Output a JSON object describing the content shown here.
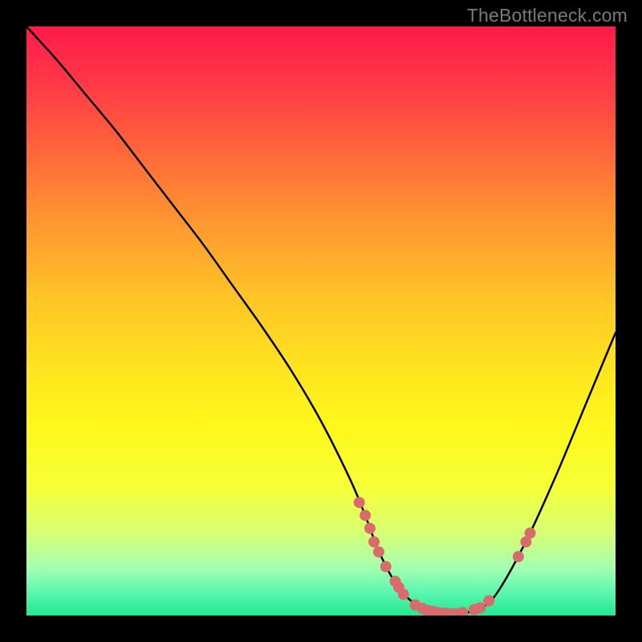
{
  "watermark": "TheBottleneck.com",
  "chart_data": {
    "type": "line",
    "title": "",
    "xlabel": "",
    "ylabel": "",
    "xlim": [
      0,
      100
    ],
    "ylim": [
      0,
      100
    ],
    "grid": false,
    "legend": false,
    "curve": {
      "x": [
        0,
        5,
        10,
        15,
        20,
        25,
        30,
        35,
        40,
        45,
        50,
        55,
        57.5,
        60,
        63,
        66,
        70,
        73,
        77,
        80,
        85,
        90,
        95,
        100
      ],
      "y": [
        100,
        94.5,
        88.5,
        82.5,
        76,
        69.5,
        63,
        56,
        49,
        41.5,
        33,
        23,
        17,
        10.5,
        5,
        2,
        0.5,
        0.3,
        1.2,
        4,
        13,
        24,
        36,
        48
      ]
    },
    "points": [
      {
        "x": 56.5,
        "y": 19.2
      },
      {
        "x": 57.5,
        "y": 17.0
      },
      {
        "x": 58.3,
        "y": 14.8
      },
      {
        "x": 59.0,
        "y": 12.5
      },
      {
        "x": 59.8,
        "y": 10.8
      },
      {
        "x": 61.0,
        "y": 8.3
      },
      {
        "x": 62.6,
        "y": 5.8
      },
      {
        "x": 63.2,
        "y": 4.8
      },
      {
        "x": 64.0,
        "y": 3.6
      },
      {
        "x": 66.0,
        "y": 1.8
      },
      {
        "x": 67.2,
        "y": 1.2
      },
      {
        "x": 68.0,
        "y": 0.9
      },
      {
        "x": 69.0,
        "y": 0.7
      },
      {
        "x": 70.0,
        "y": 0.5
      },
      {
        "x": 71.0,
        "y": 0.4
      },
      {
        "x": 72.0,
        "y": 0.3
      },
      {
        "x": 72.8,
        "y": 0.3
      },
      {
        "x": 74.0,
        "y": 0.5
      },
      {
        "x": 76.0,
        "y": 1.0
      },
      {
        "x": 77.0,
        "y": 1.3
      },
      {
        "x": 78.5,
        "y": 2.5
      },
      {
        "x": 83.5,
        "y": 10.0
      },
      {
        "x": 84.8,
        "y": 12.5
      },
      {
        "x": 85.5,
        "y": 14.0
      }
    ]
  }
}
